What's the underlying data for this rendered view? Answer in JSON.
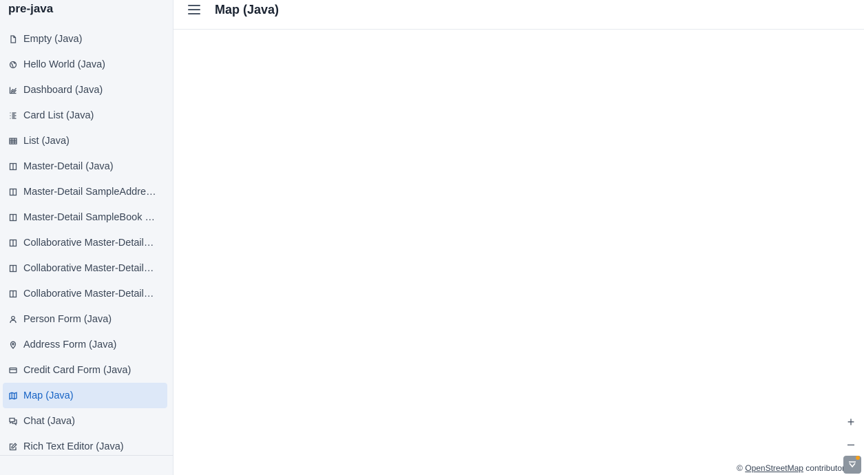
{
  "app": {
    "name": "pre-java"
  },
  "navbar": {
    "title": "Map (Java)"
  },
  "sidebar": {
    "items": [
      {
        "label": "Empty (Java)",
        "icon": "file-icon"
      },
      {
        "label": "Hello World (Java)",
        "icon": "globe-icon"
      },
      {
        "label": "Dashboard (Java)",
        "icon": "chart-icon"
      },
      {
        "label": "Card List (Java)",
        "icon": "list-icon"
      },
      {
        "label": "List (Java)",
        "icon": "grid-icon"
      },
      {
        "label": "Master-Detail (Java)",
        "icon": "columns-icon"
      },
      {
        "label": "Master-Detail SampleAddress (Java)",
        "icon": "columns-icon"
      },
      {
        "label": "Master-Detail SampleBook (Java)",
        "icon": "columns-icon"
      },
      {
        "label": "Collaborative Master-Detail (Java)",
        "icon": "columns-icon"
      },
      {
        "label": "Collaborative Master-Detail SampleAddress (Java)",
        "icon": "columns-icon"
      },
      {
        "label": "Collaborative Master-Detail SampleBook (Java)",
        "icon": "columns-icon"
      },
      {
        "label": "Person Form (Java)",
        "icon": "user-icon"
      },
      {
        "label": "Address Form (Java)",
        "icon": "map-pin-icon"
      },
      {
        "label": "Credit Card Form (Java)",
        "icon": "credit-card-icon"
      },
      {
        "label": "Map (Java)",
        "icon": "map-icon",
        "active": true
      },
      {
        "label": "Chat (Java)",
        "icon": "chat-icon"
      },
      {
        "label": "Rich Text Editor (Java)",
        "icon": "edit-icon"
      }
    ]
  },
  "map": {
    "zoom_in": "+",
    "zoom_out": "–",
    "attribution_prefix": "©",
    "attribution_link": "OpenStreetMap",
    "attribution_suffix": "contributors"
  },
  "colors": {
    "accent": "#1763c5",
    "active_bg": "#dde8f8",
    "sidebar_bg": "#f4f6f9"
  }
}
